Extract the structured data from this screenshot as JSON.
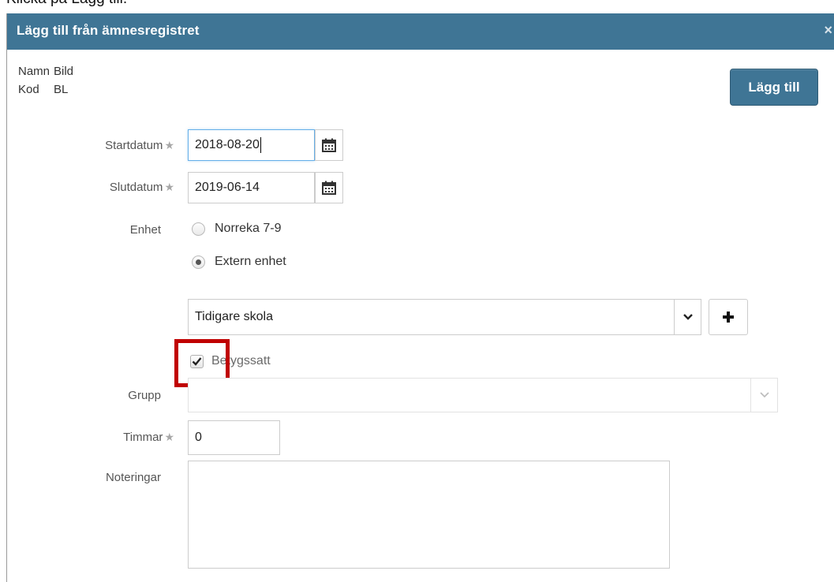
{
  "caption": "Klicka på Lägg till.",
  "dialog": {
    "title": "Lägg till från ämnesregistret",
    "close_glyph": "×"
  },
  "info": {
    "name_label": "Namn",
    "name_value": "Bild",
    "code_label": "Kod",
    "code_value": "BL"
  },
  "add_button_label": "Lägg till",
  "form": {
    "start_label": "Startdatum",
    "start_value": "2018-08-20",
    "end_label": "Slutdatum",
    "end_value": "2019-06-14",
    "required_glyph": "★",
    "unit_label": "Enhet",
    "unit_options": [
      "Norreka 7-9",
      "Extern enhet"
    ],
    "unit_selected": "Extern enhet",
    "school_value": "Tidigare skola",
    "graded_label": "Betygssatt",
    "graded_checked": true,
    "group_label": "Grupp",
    "group_value": "",
    "hours_label": "Timmar",
    "hours_value": "0",
    "notes_label": "Noteringar",
    "notes_value": ""
  },
  "icons": {
    "calendar": "calendar-icon",
    "dropdown": "chevron-down-icon",
    "add": "plus-icon",
    "close": "close-icon",
    "required": "star-icon",
    "checkmark": "checkmark-icon"
  },
  "colors": {
    "titlebar": "#3f7595",
    "primary_button": "#3f7595",
    "highlight": "#c00000",
    "focus_border": "#66afe9"
  }
}
